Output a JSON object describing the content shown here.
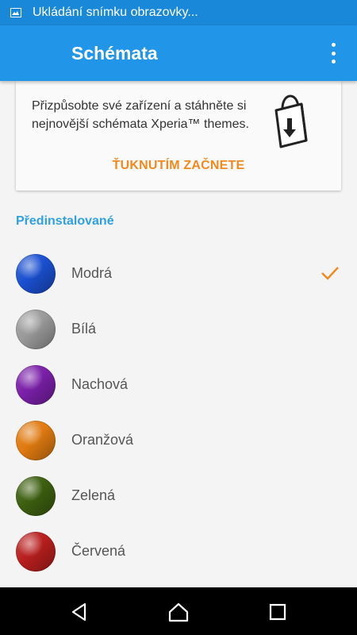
{
  "status_bar": {
    "notification_text": "Ukládání snímku obrazovky...",
    "icon": "image-icon"
  },
  "app_bar": {
    "title": "Schémata",
    "menu_icon": "more-vert-icon"
  },
  "promo_card": {
    "text": "Přizpůsobte své zařízení a stáhněte si nejnovější schémata Xperia™ themes.",
    "action_label": "ŤUKNUTÍM ZAČNETE",
    "icon": "shopping-bag-download-icon"
  },
  "section": {
    "title": "Předinstalované"
  },
  "themes": [
    {
      "label": "Modrá",
      "color": "#1a4fd0",
      "selected": true
    },
    {
      "label": "Bílá",
      "color": "#9a9a9a",
      "selected": false
    },
    {
      "label": "Nachová",
      "color": "#7a1fa8",
      "selected": false
    },
    {
      "label": "Oranžová",
      "color": "#e07a10",
      "selected": false
    },
    {
      "label": "Zelená",
      "color": "#3d5f10",
      "selected": false
    },
    {
      "label": "Červená",
      "color": "#b81e1e",
      "selected": false
    }
  ],
  "colors": {
    "status_bar": "#1a88d8",
    "app_bar": "#2196e8",
    "accent_orange": "#f08a1e",
    "section_blue": "#2fa0e0"
  },
  "nav_bar": {
    "icons": [
      "back-icon",
      "home-icon",
      "recents-icon"
    ]
  }
}
